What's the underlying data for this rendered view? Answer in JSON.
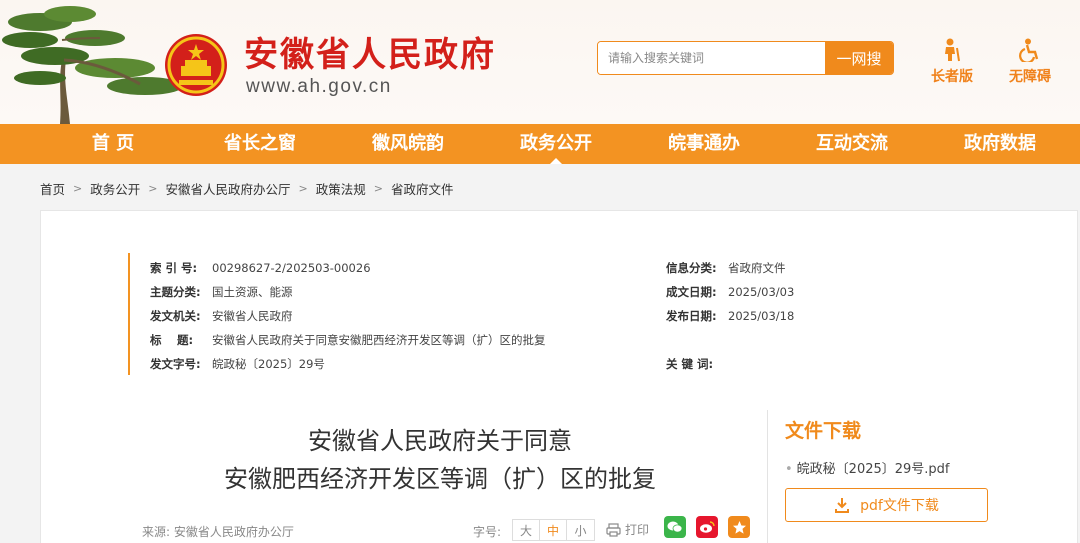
{
  "header": {
    "site_title": "安徽省人民政府",
    "site_url": "www.ah.gov.cn",
    "search_placeholder": "请输入搜索关键词",
    "search_button": "一网搜",
    "tools": [
      {
        "label": "长者版",
        "icon": "elder-icon"
      },
      {
        "label": "无障碍",
        "icon": "accessibility-icon"
      }
    ]
  },
  "nav": {
    "items": [
      "首 页",
      "省长之窗",
      "徽风皖韵",
      "政务公开",
      "皖事通办",
      "互动交流",
      "政府数据"
    ],
    "active": "政务公开"
  },
  "breadcrumb": [
    "首页",
    "政务公开",
    "安徽省人民政府办公厅",
    "政策法规",
    "省政府文件"
  ],
  "meta": {
    "index_no_label": "索 引 号:",
    "index_no": "00298627-2/202503-00026",
    "category_label": "信息分类:",
    "category": "省政府文件",
    "topic_label": "主题分类:",
    "topic": "国土资源、能源",
    "created_label": "成文日期:",
    "created": "2025/03/03",
    "issuer_label": "发文机关:",
    "issuer": "安徽省人民政府",
    "published_label": "发布日期:",
    "published": "2025/03/18",
    "title_label": "标　 题:",
    "title": "安徽省人民政府关于同意安徽肥西经济开发区等调（扩）区的批复",
    "doc_no_label": "发文字号:",
    "doc_no": "皖政秘〔2025〕29号",
    "keywords_label": "关 键 词:",
    "keywords": ""
  },
  "document": {
    "title_line1": "安徽省人民政府关于同意",
    "title_line2": "安徽肥西经济开发区等调（扩）区的批复",
    "source_label": "来源:",
    "source": "安徽省人民政府办公厅",
    "font_size_label": "字号:",
    "font_sizes": [
      "大",
      "中",
      "小"
    ],
    "font_size_selected": "中",
    "print_label": "打印",
    "share": [
      {
        "icon": "wechat-icon",
        "color": "#3bb54a"
      },
      {
        "icon": "weibo-icon",
        "color": "#e6162d"
      },
      {
        "icon": "favorite-icon",
        "color": "#f08a1c"
      }
    ]
  },
  "download": {
    "title": "文件下载",
    "file_name": "皖政秘〔2025〕29号.pdf",
    "button_label": "pdf文件下载"
  },
  "colors": {
    "brand_orange": "#f39322",
    "title_red": "#d3201a"
  }
}
